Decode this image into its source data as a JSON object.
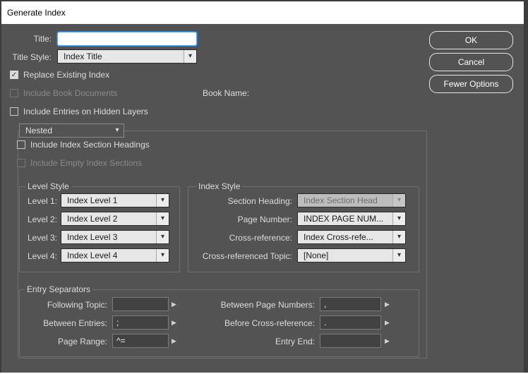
{
  "window": {
    "title": "Generate Index"
  },
  "form": {
    "title_label": "Title:",
    "title_value": "",
    "title_style_label": "Title Style:",
    "title_style_value": "Index Title",
    "replace_existing_label": "Replace Existing Index",
    "include_book_docs_label": "Include Book Documents",
    "book_name_label": "Book Name:",
    "include_hidden_layers_label": "Include Entries on Hidden Layers",
    "format_value": "Nested",
    "include_section_headings_label": "Include Index Section Headings",
    "include_empty_sections_label": "Include Empty Index Sections"
  },
  "level_style": {
    "title": "Level Style",
    "levels": [
      {
        "label": "Level 1:",
        "value": "Index Level 1"
      },
      {
        "label": "Level 2:",
        "value": "Index Level 2"
      },
      {
        "label": "Level 3:",
        "value": "Index Level 3"
      },
      {
        "label": "Level 4:",
        "value": "Index Level 4"
      }
    ]
  },
  "index_style": {
    "title": "Index Style",
    "rows": [
      {
        "label": "Section Heading:",
        "value": "Index Section Head"
      },
      {
        "label": "Page Number:",
        "value": "INDEX PAGE NUM..."
      },
      {
        "label": "Cross-reference:",
        "value": "Index Cross-refe..."
      },
      {
        "label": "Cross-referenced Topic:",
        "value": "[None]"
      }
    ]
  },
  "separators": {
    "title": "Entry Separators",
    "left": [
      {
        "label": "Following Topic:",
        "value": ""
      },
      {
        "label": "Between Entries:",
        "value": ";"
      },
      {
        "label": "Page Range:",
        "value": "^="
      }
    ],
    "right": [
      {
        "label": "Between Page Numbers:",
        "value": ","
      },
      {
        "label": "Before Cross-reference:",
        "value": "."
      },
      {
        "label": "Entry End:",
        "value": ""
      }
    ]
  },
  "buttons": {
    "ok": "OK",
    "cancel": "Cancel",
    "fewer": "Fewer Options"
  },
  "icons": {
    "dropdown": "chevron-down-icon",
    "arrow": "triangle-right-icon",
    "check": "checkmark-icon"
  },
  "colors": {
    "dialog_bg": "#535353",
    "focus": "#4aa3ff"
  }
}
